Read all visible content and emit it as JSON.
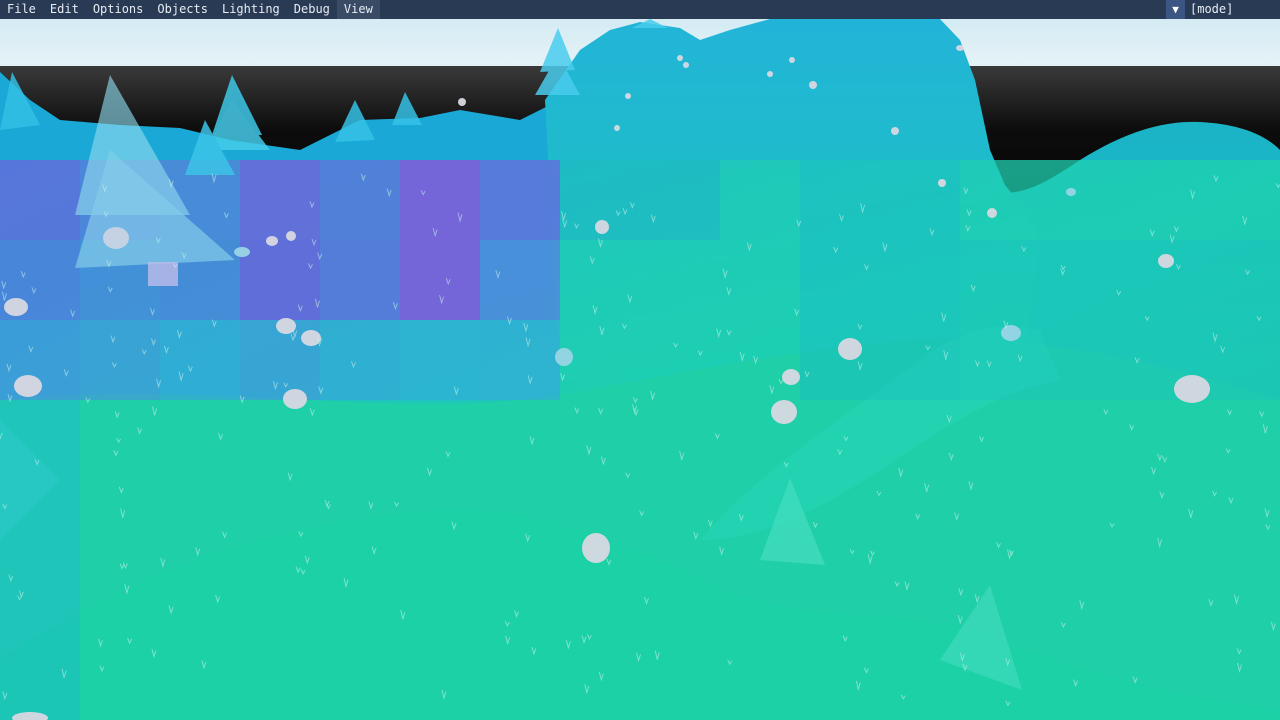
{
  "menubar": {
    "items": [
      {
        "label": "File",
        "active": false
      },
      {
        "label": "Edit",
        "active": false
      },
      {
        "label": "Options",
        "active": false
      },
      {
        "label": "Objects",
        "active": false
      },
      {
        "label": "Lighting",
        "active": false
      },
      {
        "label": "Debug",
        "active": false
      },
      {
        "label": "View",
        "active": true
      }
    ],
    "mode_value": "[mode]"
  },
  "scene": {
    "sky_color": "#dbeef5",
    "terrain_color": "#1fd0ab",
    "mountain_color": "#14bcc4",
    "debug_overlay_color": "#7a4fe0"
  }
}
